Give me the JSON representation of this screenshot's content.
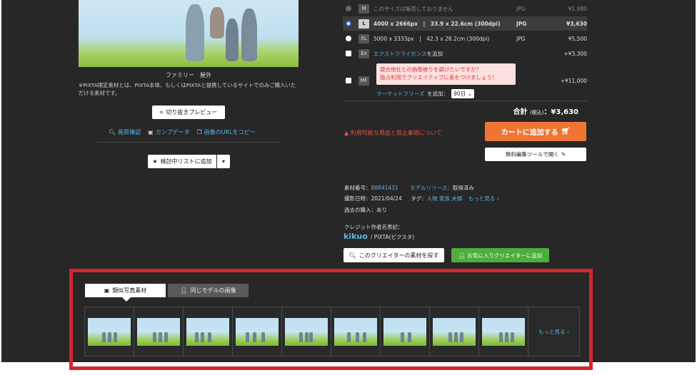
{
  "photo": {
    "caption": "ファミリー　屋外",
    "note": "※PIXTA限定素材とは、PIXTA本体、もしくはPIXTAと提携しているサイトでのみご購入いただける素材です。"
  },
  "left_actions": {
    "crop_preview": "切り抜きプレビュー",
    "links": [
      {
        "icon": "magnifier-icon",
        "label": "画質確認"
      },
      {
        "icon": "image-icon",
        "label": "カンプデータ"
      },
      {
        "icon": "copy-icon",
        "label": "画像のURLをコピー"
      }
    ],
    "add_to_list": "検討中リストに追加"
  },
  "sizes": [
    {
      "badge": "M",
      "dims": "このサイズは販売しておりません",
      "format": "JPG",
      "price": "¥1,980",
      "state": "disabled"
    },
    {
      "badge": "L",
      "dims": "4000 x 2666px　|　33.9 x 22.6cm (300dpi)",
      "format": "JPG",
      "price": "¥3,630",
      "state": "selected"
    },
    {
      "badge": "XL",
      "dims": "5000 x 3333px　|　42.3 x 28.2cm (300dpi)",
      "format": "JPG",
      "price": "¥5,500",
      "state": "normal"
    }
  ],
  "options": {
    "ex_badge": "Ex",
    "ex_label": "エクストラライセンス",
    "ex_suffix": "を追加",
    "ex_price": "+¥3,300",
    "mf_badge": "MF",
    "mf_promo_line1": "競合他社との画像被りを避けたいですか？",
    "mf_promo_line2": "独占利用でクリエイティブに差をつけましょう！",
    "mf_price": "+¥11,000",
    "mf_link": "マーケットフリーズ",
    "mf_suffix": "を追加：",
    "mf_period": "90日"
  },
  "total": {
    "label": "合計",
    "tax": "(税込)",
    "amount": "：¥3,630"
  },
  "warning": "利用可能な用途と禁止事項について",
  "cart_button": "カートに追加する",
  "free_tool_button": "無料編集ツールで開く",
  "meta": {
    "id_label": "素材番号：",
    "id_value": "88841431",
    "model_label": "モデルリリース：",
    "model_value": "取得済み",
    "date_label": "撮影日時：",
    "date_value": "2021/04/24",
    "tag_label": "タグ：",
    "tags": [
      "人物",
      "家族",
      "夫婦"
    ],
    "tag_more": "もっと見る ›",
    "past_label": "過去の購入：",
    "past_value": "あり",
    "credit_label": "クレジット作者名表記：",
    "creator": "kikuo",
    "credit_suffix": "/ PIXTA(ピクスタ)"
  },
  "creator_buttons": {
    "find": "このクリエイターの素材を探す",
    "favorite": "お気に入りクリエイターに追加"
  },
  "similar": {
    "tab_active": "類似写真素材",
    "tab_inactive": "同じモデルの画像",
    "thumb_count": 9,
    "more": "もっと見る ›"
  },
  "colors": {
    "accent_blue": "#59b3e6",
    "cart_orange": "#f07535",
    "highlight_red": "#d2262b",
    "green": "#4cae3b"
  }
}
